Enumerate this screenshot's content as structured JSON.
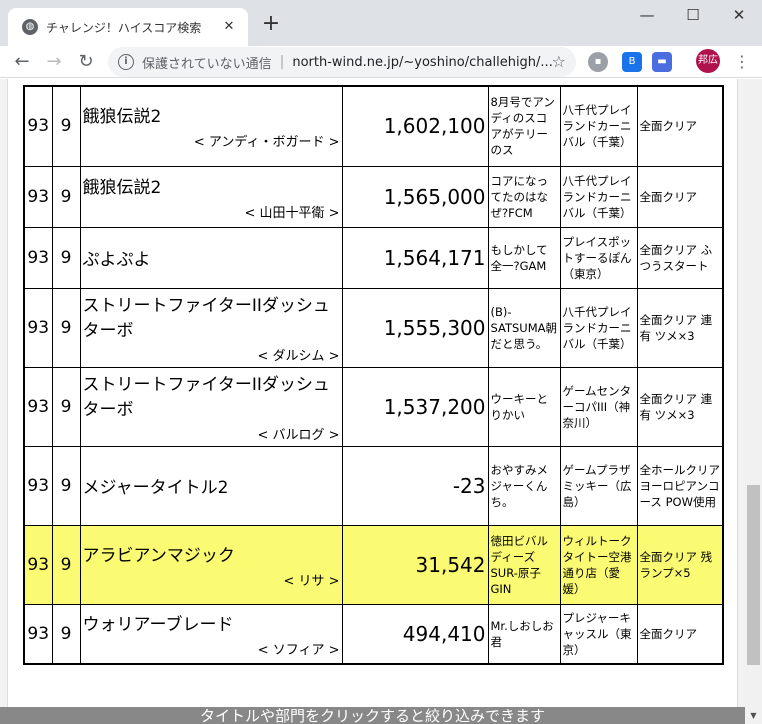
{
  "browser": {
    "tab_title": "チャレンジ！ハイスコア検索",
    "security_label": "保護されていない通信",
    "url": "north-wind.ne.jp/~yoshino/challehigh/...",
    "avatar_label": "邦広",
    "ext_b_label": "B"
  },
  "rows": [
    {
      "rank": "93",
      "sub": "9",
      "title": "餓狼伝説2",
      "character": "< アンディ・ボガード >",
      "score": "1,602,100",
      "note": "8月号でアンディのスコアがテリーのス",
      "shop": "八千代プレイランドカーニバル（千葉）",
      "cond": "全面クリア",
      "height": 80,
      "highlight": false
    },
    {
      "rank": "93",
      "sub": "9",
      "title": "餓狼伝説2",
      "character": "< 山田十平衛 >",
      "score": "1,565,000",
      "note": "コアになってたのはなぜ?FCM",
      "shop": "八千代プレイランドカーニバル（千葉）",
      "cond": "全面クリア",
      "height": 61,
      "highlight": false
    },
    {
      "rank": "93",
      "sub": "9",
      "title": "ぷよぷよ",
      "character": "",
      "score": "1,564,171",
      "note": "もしかして全一?GAM",
      "shop": "プレイスポットすーるぽん（東京）",
      "cond": "全面クリア ふつうスタート",
      "height": 61,
      "highlight": false
    },
    {
      "rank": "93",
      "sub": "9",
      "title": "ストリートファイターIIダッシュターボ",
      "character": "< ダルシム >",
      "score": "1,555,300",
      "note": "(B)-SATSUMA朝だと思う。",
      "shop": "八千代プレイランドカーニバル（千葉）",
      "cond": "全面クリア 連有 ツメ×3",
      "height": 79,
      "highlight": false
    },
    {
      "rank": "93",
      "sub": "9",
      "title": "ストリートファイターIIダッシュターボ",
      "character": "< バルログ >",
      "score": "1,537,200",
      "note": "ウーキーとりかい",
      "shop": "ゲームセンターコパIII（神奈川）",
      "cond": "全面クリア 連有 ツメ×3",
      "height": 79,
      "highlight": false
    },
    {
      "rank": "93",
      "sub": "9",
      "title": "メジャータイトル2",
      "character": "",
      "score": "-23",
      "note": "おやすみメジャーくんち。",
      "shop": "ゲームプラザミッキー（広島）",
      "cond": "全ホールクリア ヨーロピアンコース POW使用",
      "height": 79,
      "highlight": false
    },
    {
      "rank": "93",
      "sub": "9",
      "title": "アラビアンマジック",
      "character": "< リサ >",
      "score": "31,542",
      "note": "徳田ビバルディーズSUR-原子GIN",
      "shop": "ウィルトークタイトー空港通り店（愛媛）",
      "cond": "全面クリア 残ランプ×5",
      "height": 79,
      "highlight": true
    },
    {
      "rank": "93",
      "sub": "9",
      "title": "ウォリアーブレード",
      "character": "< ソフィア >",
      "score": "494,410",
      "note": "Mr.しおしお君",
      "shop": "プレジャーキャッスル（東京）",
      "cond": "全面クリア",
      "height": 60,
      "highlight": false
    }
  ],
  "footer": "タイトルや部門をクリックすると絞り込みできます"
}
